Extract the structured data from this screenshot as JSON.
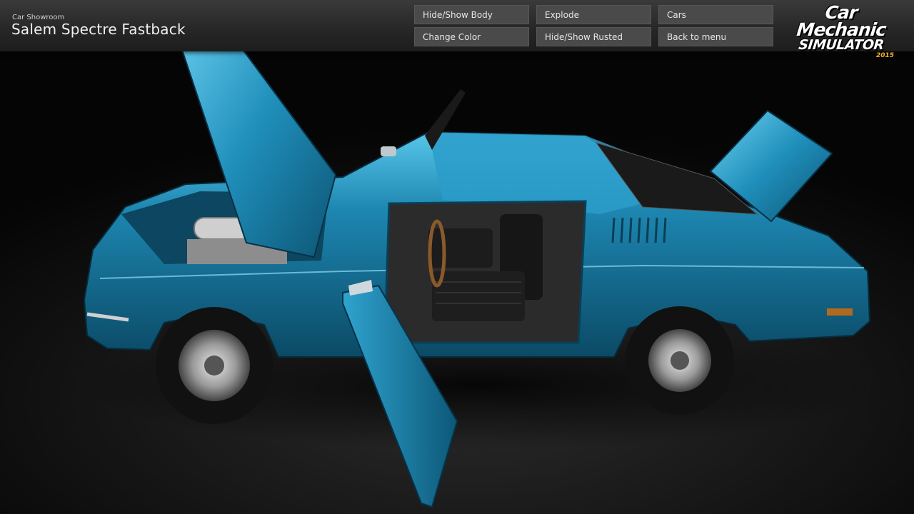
{
  "header": {
    "section": "Car Showroom",
    "car_name": "Salem Spectre Fastback"
  },
  "menu": {
    "hide_show_body": "Hide/Show Body",
    "explode": "Explode",
    "cars": "Cars",
    "change_color": "Change Color",
    "hide_show_rusted": "Hide/Show Rusted",
    "back_to_menu": "Back to menu"
  },
  "logo": {
    "line1": "Car",
    "line2": "Mechanic",
    "line3": "SIMULATOR",
    "year": "2015"
  },
  "colors": {
    "car_body": "#1a7fa8",
    "car_highlight": "#4fc3e6",
    "button_bg": "#4a4a4a",
    "logo_year": "#f2b21c"
  }
}
